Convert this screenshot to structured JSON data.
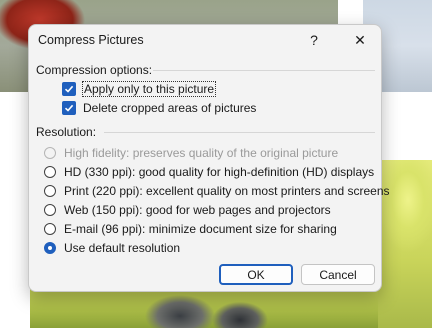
{
  "dialog": {
    "title": "Compress Pictures",
    "help_glyph": "?",
    "close_glyph": "✕"
  },
  "compression": {
    "group_label": "Compression options:",
    "options": [
      {
        "label": "Apply only to this picture",
        "checked": true
      },
      {
        "label": "Delete cropped areas of pictures",
        "checked": true
      }
    ]
  },
  "resolution": {
    "group_label": "Resolution:",
    "options": [
      {
        "label": "High fidelity: preserves quality of the original picture",
        "enabled": false,
        "selected": false
      },
      {
        "label": "HD (330 ppi): good quality for high-definition (HD) displays",
        "enabled": true,
        "selected": false
      },
      {
        "label": "Print (220 ppi): excellent quality on most printers and screens",
        "enabled": true,
        "selected": false
      },
      {
        "label": "Web (150 ppi): good for web pages and projectors",
        "enabled": true,
        "selected": false
      },
      {
        "label": "E-mail (96 ppi): minimize document size for sharing",
        "enabled": true,
        "selected": false
      },
      {
        "label": "Use default resolution",
        "enabled": true,
        "selected": true
      }
    ]
  },
  "buttons": {
    "ok": "OK",
    "cancel": "Cancel"
  },
  "colors": {
    "accent": "#1f5fbd",
    "dialog_bg": "#f3f3f3"
  }
}
